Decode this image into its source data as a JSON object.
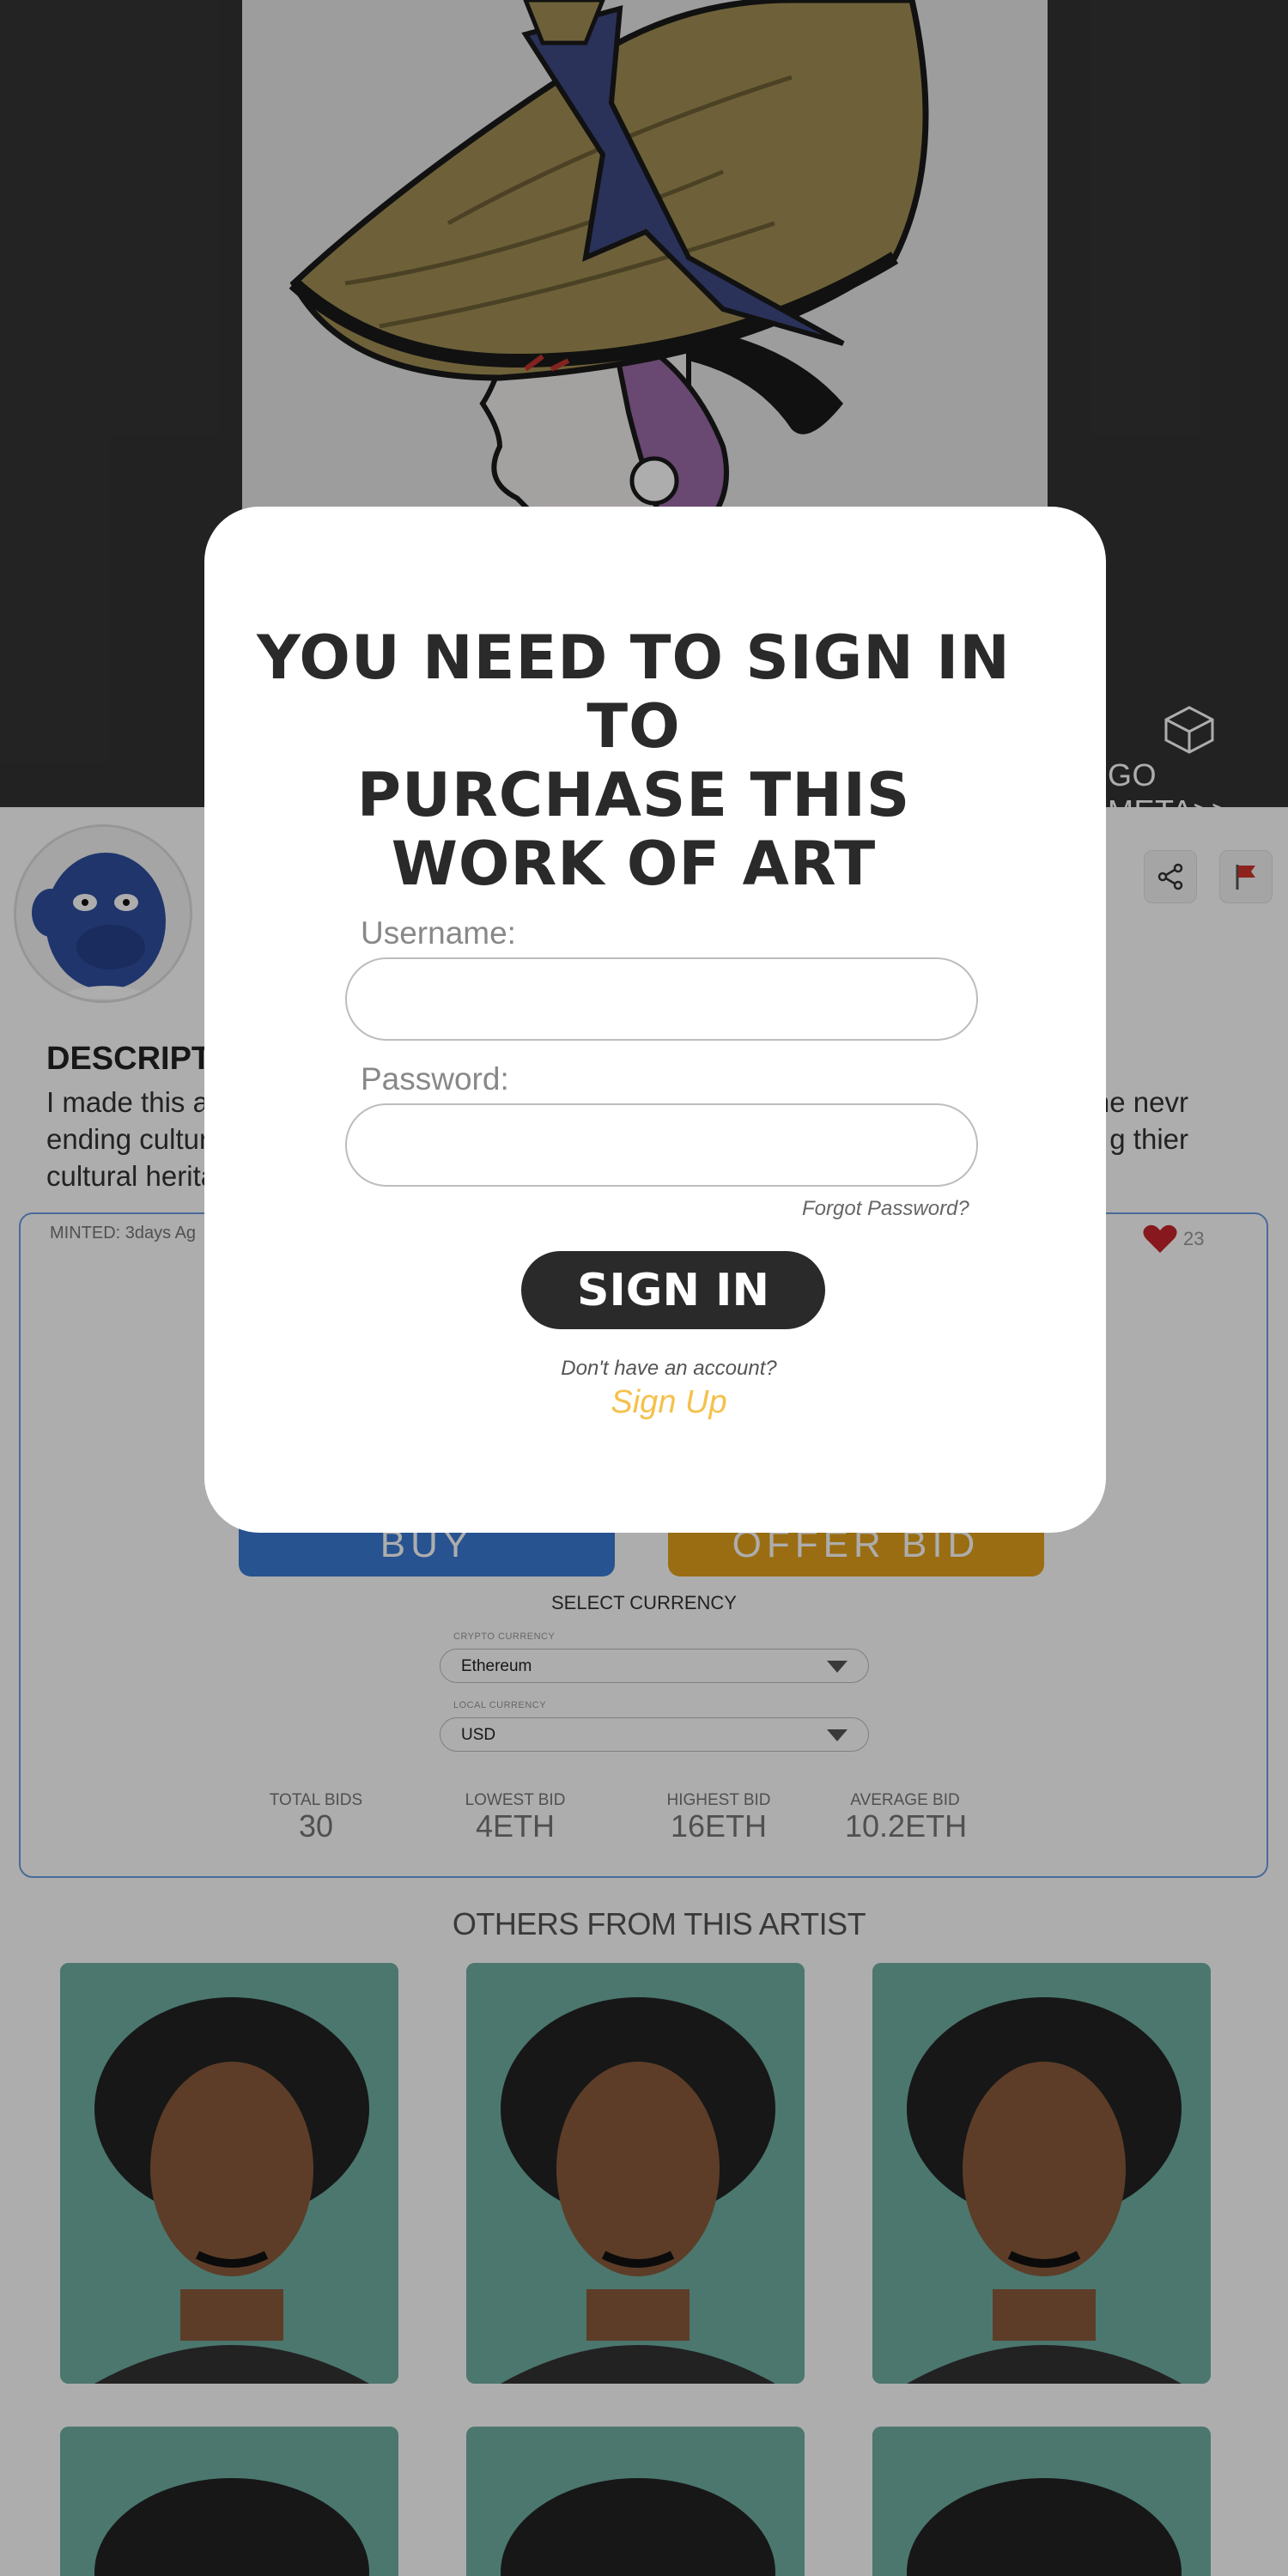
{
  "hero": {
    "go_meta_label": "GO META>>",
    "go_meta_icon": "cube-icon"
  },
  "actions": {
    "bookmark_icon": "bookmark-icon",
    "share_icon": "share-icon",
    "report_icon": "flag-icon"
  },
  "description": {
    "title": "DESCRIPTIC",
    "text_line1_left": "I made this ar",
    "text_line1_right": "he nevr",
    "text_line2_left": "ending cultur",
    "text_line2_right": "g thier",
    "text_line3_left": "cultural herita"
  },
  "listing": {
    "minted": "MINTED: 3days Ag",
    "likes": "23",
    "buy_label": "BUY",
    "offer_label": "OFFER BID",
    "select_currency": "SELECT CURRENCY",
    "crypto_label": "CRYPTO CURRENCY",
    "crypto_value": "Ethereum",
    "local_label": "LOCAL CURRENCY",
    "local_value": "USD",
    "stats": [
      {
        "label": "TOTAL BIDS",
        "value": "30"
      },
      {
        "label": "LOWEST BID",
        "value": "4ETH"
      },
      {
        "label": "HIGHEST BID",
        "value": "16ETH"
      },
      {
        "label": "AVERAGE BID",
        "value": "10.2ETH"
      }
    ]
  },
  "others": {
    "title": "OTHERS FROM THIS ARTIST"
  },
  "modal": {
    "title_line1": "YOU NEED TO SIGN IN TO",
    "title_line2": "PURCHASE THIS",
    "title_line3": "WORK OF ART",
    "username_label": "Username:",
    "password_label": "Password:",
    "forgot": "Forgot Password?",
    "signin": "SIGN IN",
    "no_account": "Don't have an account?",
    "signup": "Sign Up"
  },
  "colors": {
    "accent_blue": "#3a7bd5",
    "accent_orange": "#e4a11b",
    "signup_yellow": "#f5c14b",
    "modal_dark": "#2a2a2a"
  }
}
